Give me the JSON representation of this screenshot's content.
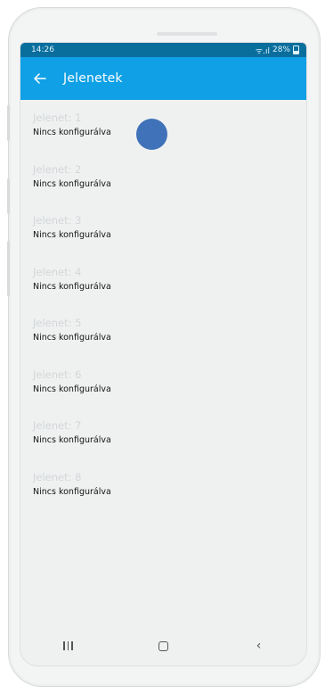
{
  "status_bar": {
    "time": "14:26",
    "signal": "ᯤ.ıl",
    "battery_percent": "28%"
  },
  "app_bar": {
    "back_icon": "arrow-left-icon",
    "title": "Jelenetek"
  },
  "scenes": [
    {
      "title": "Jelenet: 1",
      "status": "Nincs konfigurálva"
    },
    {
      "title": "Jelenet: 2",
      "status": "Nincs konfigurálva"
    },
    {
      "title": "Jelenet: 3",
      "status": "Nincs konfigurálva"
    },
    {
      "title": "Jelenet: 4",
      "status": "Nincs konfigurálva"
    },
    {
      "title": "Jelenet: 5",
      "status": "Nincs konfigurálva"
    },
    {
      "title": "Jelenet: 6",
      "status": "Nincs konfigurálva"
    },
    {
      "title": "Jelenet: 7",
      "status": "Nincs konfigurálva"
    },
    {
      "title": "Jelenet: 8",
      "status": "Nincs konfigurálva"
    }
  ],
  "nav_bar": {
    "recents_icon": "recents-icon",
    "home_icon": "home-icon",
    "back_icon": "chevron-left-icon",
    "back_glyph": "‹"
  },
  "colors": {
    "status_bar": "#0a6e9d",
    "app_bar": "#0fa0e6",
    "touch_indicator": "#3f72b8"
  }
}
